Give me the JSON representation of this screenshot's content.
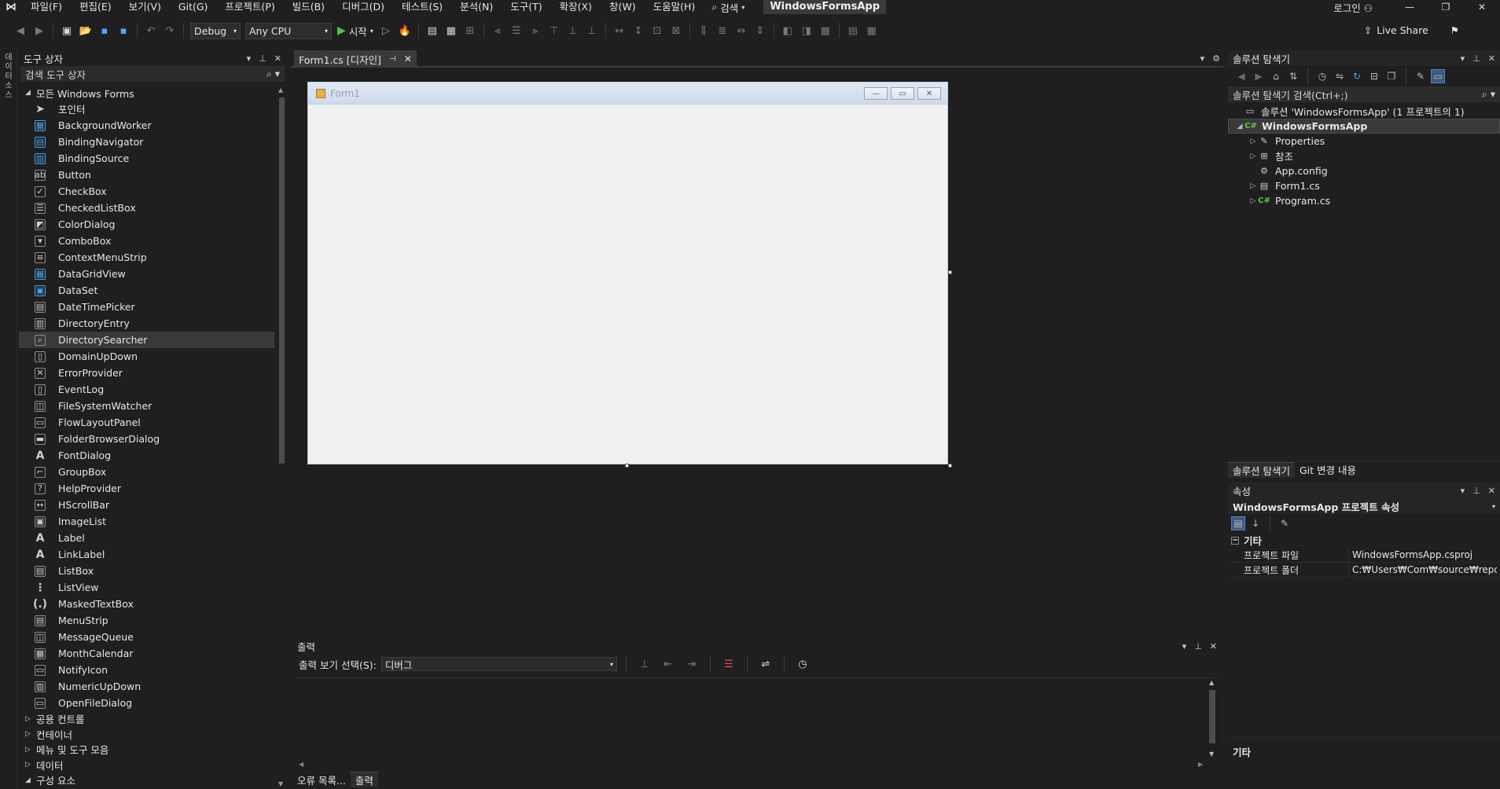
{
  "menubar": {
    "items": [
      "파일(F)",
      "편집(E)",
      "보기(V)",
      "Git(G)",
      "프로젝트(P)",
      "빌드(B)",
      "디버그(D)",
      "테스트(S)",
      "분석(N)",
      "도구(T)",
      "확장(X)",
      "창(W)",
      "도움말(H)"
    ],
    "search_label": "검색",
    "app_title": "WindowsFormsApp",
    "login": "로그인"
  },
  "toolbar": {
    "config": "Debug",
    "platform": "Any CPU",
    "run_label": "시작",
    "live_share": "Live Share"
  },
  "left_strip": {
    "label": "데이터 소스"
  },
  "toolbox": {
    "title": "도구 상자",
    "search_placeholder": "검색 도구 상자",
    "group_all": "모든 Windows Forms",
    "items": [
      {
        "label": "포인터",
        "icon": "pointer-icon",
        "glyph": "➤"
      },
      {
        "label": "BackgroundWorker",
        "icon": "background-worker-icon",
        "glyph": "▦"
      },
      {
        "label": "BindingNavigator",
        "icon": "binding-navigator-icon",
        "glyph": "▤"
      },
      {
        "label": "BindingSource",
        "icon": "binding-source-icon",
        "glyph": "▥"
      },
      {
        "label": "Button",
        "icon": "button-icon",
        "glyph": "ab"
      },
      {
        "label": "CheckBox",
        "icon": "checkbox-icon",
        "glyph": "✓"
      },
      {
        "label": "CheckedListBox",
        "icon": "checked-listbox-icon",
        "glyph": "☰"
      },
      {
        "label": "ColorDialog",
        "icon": "color-dialog-icon",
        "glyph": "◩"
      },
      {
        "label": "ComboBox",
        "icon": "combobox-icon",
        "glyph": "▾"
      },
      {
        "label": "ContextMenuStrip",
        "icon": "context-menu-strip-icon",
        "glyph": "≡"
      },
      {
        "label": "DataGridView",
        "icon": "datagridview-icon",
        "glyph": "▦"
      },
      {
        "label": "DataSet",
        "icon": "dataset-icon",
        "glyph": "▣"
      },
      {
        "label": "DateTimePicker",
        "icon": "datetimepicker-icon",
        "glyph": "▤"
      },
      {
        "label": "DirectoryEntry",
        "icon": "directory-entry-icon",
        "glyph": "▥"
      },
      {
        "label": "DirectorySearcher",
        "icon": "directory-searcher-icon",
        "glyph": "⌕"
      },
      {
        "label": "DomainUpDown",
        "icon": "domain-updown-icon",
        "glyph": "▯"
      },
      {
        "label": "ErrorProvider",
        "icon": "error-provider-icon",
        "glyph": "✕"
      },
      {
        "label": "EventLog",
        "icon": "eventlog-icon",
        "glyph": "▯"
      },
      {
        "label": "FileSystemWatcher",
        "icon": "filesystem-watcher-icon",
        "glyph": "◫"
      },
      {
        "label": "FlowLayoutPanel",
        "icon": "flow-layout-panel-icon",
        "glyph": "▭"
      },
      {
        "label": "FolderBrowserDialog",
        "icon": "folder-browser-dialog-icon",
        "glyph": "▬"
      },
      {
        "label": "FontDialog",
        "icon": "font-dialog-icon",
        "glyph": "A"
      },
      {
        "label": "GroupBox",
        "icon": "groupbox-icon",
        "glyph": "⌐"
      },
      {
        "label": "HelpProvider",
        "icon": "help-provider-icon",
        "glyph": "?"
      },
      {
        "label": "HScrollBar",
        "icon": "hscrollbar-icon",
        "glyph": "↔"
      },
      {
        "label": "ImageList",
        "icon": "imagelist-icon",
        "glyph": "▣"
      },
      {
        "label": "Label",
        "icon": "label-icon",
        "glyph": "A"
      },
      {
        "label": "LinkLabel",
        "icon": "linklabel-icon",
        "glyph": "A"
      },
      {
        "label": "ListBox",
        "icon": "listbox-icon",
        "glyph": "▤"
      },
      {
        "label": "ListView",
        "icon": "listview-icon",
        "glyph": "⋮"
      },
      {
        "label": "MaskedTextBox",
        "icon": "masked-textbox-icon",
        "glyph": "(.)"
      },
      {
        "label": "MenuStrip",
        "icon": "menustrip-icon",
        "glyph": "▤"
      },
      {
        "label": "MessageQueue",
        "icon": "message-queue-icon",
        "glyph": "◫"
      },
      {
        "label": "MonthCalendar",
        "icon": "month-calendar-icon",
        "glyph": "▦"
      },
      {
        "label": "NotifyIcon",
        "icon": "notify-icon-icon",
        "glyph": "▭"
      },
      {
        "label": "NumericUpDown",
        "icon": "numeric-updown-icon",
        "glyph": "▥"
      },
      {
        "label": "OpenFileDialog",
        "icon": "open-file-dialog-icon",
        "glyph": "▭"
      }
    ],
    "selected_index": 14,
    "groups_after": [
      "공용 컨트롤",
      "컨테이너",
      "메뉴 및 도구 모음",
      "데이터",
      "구성 요소"
    ]
  },
  "document": {
    "tab_label": "Form1.cs [디자인]",
    "form_title": "Form1"
  },
  "output": {
    "title": "출력",
    "show_label": "출력 보기 선택(S):",
    "show_value": "디버그",
    "bottom_tabs": [
      "오류 목록...",
      "출력"
    ]
  },
  "solution": {
    "title": "솔루션 탐색기",
    "search_placeholder": "솔루션 탐색기 검색(Ctrl+;)",
    "tree": [
      {
        "label": "솔루션 'WindowsFormsApp' (1 프로젝트의 1)",
        "level": 0,
        "exp": "",
        "icon": "solution-icon",
        "glyph": "▭"
      },
      {
        "label": "WindowsFormsApp",
        "level": 0,
        "exp": "◢",
        "icon": "csharp-project-icon",
        "glyph": "C#",
        "selected": true,
        "bold": true
      },
      {
        "label": "Properties",
        "level": 1,
        "exp": "▷",
        "icon": "wrench-icon",
        "glyph": "✎"
      },
      {
        "label": "참조",
        "level": 1,
        "exp": "▷",
        "icon": "references-icon",
        "glyph": "⊞"
      },
      {
        "label": "App.config",
        "level": 1,
        "exp": "",
        "icon": "config-file-icon",
        "glyph": "⚙"
      },
      {
        "label": "Form1.cs",
        "level": 1,
        "exp": "▷",
        "icon": "form-file-icon",
        "glyph": "▤"
      },
      {
        "label": "Program.cs",
        "level": 1,
        "exp": "▷",
        "icon": "csharp-file-icon",
        "glyph": "C#"
      }
    ],
    "tabs": [
      "솔루션 탐색기",
      "Git 변경 내용"
    ]
  },
  "properties": {
    "title": "속성",
    "object": "WindowsFormsApp  프로젝트 속성",
    "category": "기타",
    "rows": [
      {
        "name": "프로젝트 파일",
        "value": "WindowsFormsApp.csproj"
      },
      {
        "name": "프로젝트 폴더",
        "value": "C:₩Users₩Com₩source₩repos₩"
      }
    ],
    "description": "기타"
  },
  "colors": {
    "background": "#1f1f1f",
    "form_bg": "#f0f0f0",
    "accent": "#4aa3e8",
    "run_green": "#4fc14f"
  }
}
